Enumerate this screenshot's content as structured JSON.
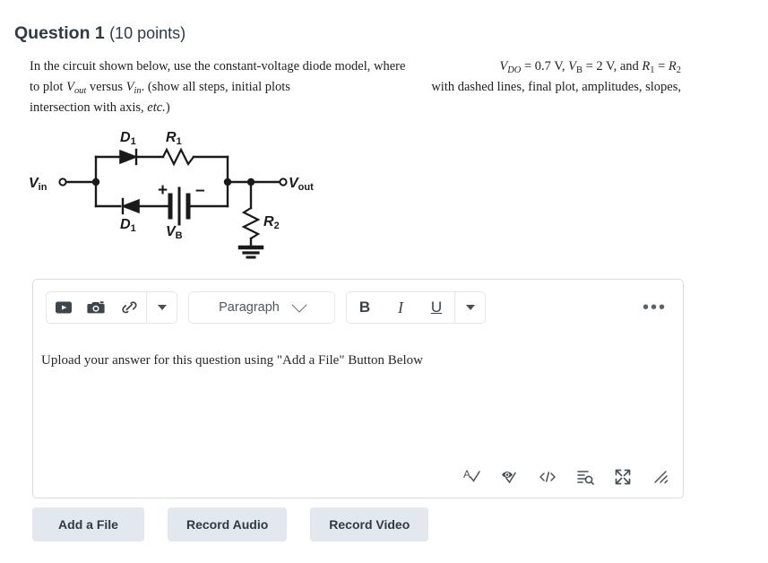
{
  "question": {
    "title": "Question 1",
    "points": "(10 points)",
    "line1_left": "In the circuit shown below, use the constant-voltage diode model, where",
    "line1_math": "V_DO = 0.7 V, V_B = 2 V, and R_1 = R_2",
    "line2_left": "to plot V_out versus V_in. (show all steps, initial plots",
    "line2_right": "with dashed lines, final plot, amplitudes, slopes,",
    "line3": "intersection with axis, etc.)",
    "tokens": {
      "vdo": "V",
      "vdo_sub": "DO",
      "vdo_val": "= 0.7 V,",
      "vb": "V",
      "vb_sub": "B",
      "vb_val": "= 2 V, and",
      "r1": "R",
      "r1_sub": "1",
      "eq": "=",
      "r2": "R",
      "r2_sub": "2",
      "to_plot": "to plot",
      "vout": "V",
      "vout_sub": "out",
      "versus": "versus",
      "vin": "V",
      "vin_sub": "in",
      "period_paren": ". (show all steps, initial plots",
      "etc": "etc.",
      "close": ")",
      "intersection": "intersection with axis,"
    }
  },
  "circuit": {
    "labels": {
      "vin": "V",
      "vin_sub": "in",
      "vout": "V",
      "vout_sub": "out",
      "d1_top": "D",
      "d1_top_sub": "1",
      "d1_bottom": "D",
      "d1_bottom_sub": "1",
      "r1": "R",
      "r1_sub": "1",
      "r2": "R",
      "r2_sub": "2",
      "vb": "V",
      "vb_sub": "B",
      "plus": "+",
      "minus": "–"
    },
    "stroke_color": "#1a1a1a"
  },
  "editor": {
    "toolbar": {
      "media_icons": [
        "video-icon",
        "image-icon",
        "link-icon"
      ],
      "more_media_label": "",
      "paragraph_label": "Paragraph",
      "bold_label": "B",
      "italic_label": "I",
      "underline_label": "U",
      "overflow_label": "•••"
    },
    "content": "Upload your answer for this question using \"Add a File\" Button Below",
    "status_icons": [
      "spellcheck-icon",
      "accessibility-checker-icon",
      "html-editor-icon",
      "word-count-icon",
      "fullscreen-icon",
      "resize-handle-icon"
    ]
  },
  "actions": {
    "add_file": "Add a File",
    "record_audio": "Record Audio",
    "record_video": "Record Video"
  },
  "colors": {
    "text": "#2d3b45",
    "border": "#d8dde2",
    "button_bg": "#e3e7ee",
    "icon": "#4a5157"
  }
}
